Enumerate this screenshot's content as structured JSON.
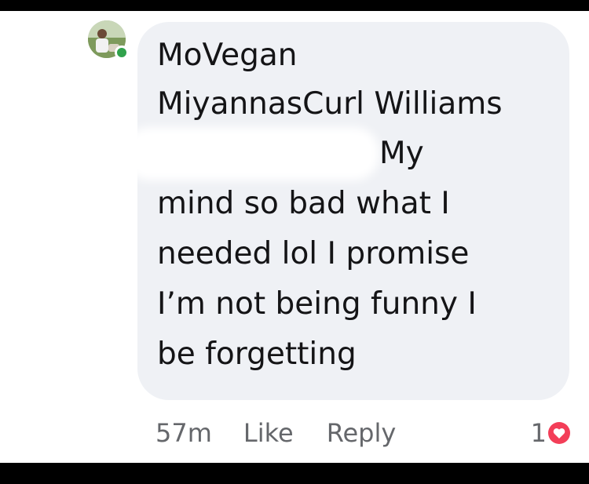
{
  "comment": {
    "author_line": "MoVegan",
    "tag_name": "MiyannasCurl Williams",
    "text_first": "My",
    "lines": [
      "mind so bad what I",
      "needed lol I promise",
      "I’m not being funny I",
      "be forgetting"
    ],
    "timestamp": "57m",
    "like_label": "Like",
    "reply_label": "Reply",
    "reaction_count": "1",
    "reaction_icon": "heart-icon",
    "colors": {
      "bubble": "#eff1f5",
      "meta_text": "#65676b",
      "online": "#31a24c",
      "reaction": "#f33e58"
    }
  }
}
